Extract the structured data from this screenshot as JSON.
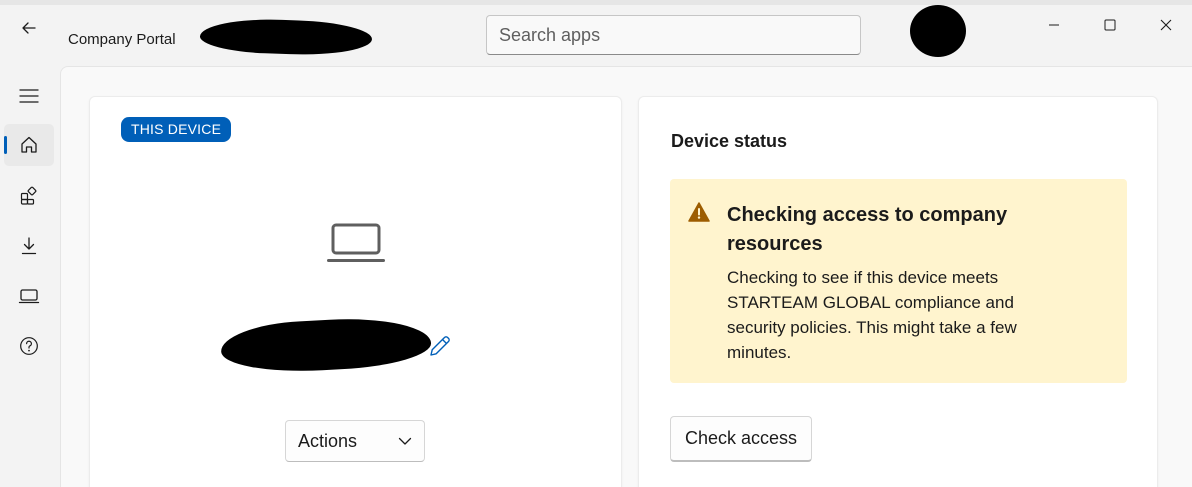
{
  "window": {
    "title": "Company Portal",
    "controls": {
      "minimize": "minimize-icon",
      "maximize": "maximize-icon",
      "close": "close-icon"
    }
  },
  "search": {
    "placeholder": "Search apps",
    "value": ""
  },
  "nav": {
    "items": [
      {
        "icon": "hamburger-menu-icon",
        "active": false
      },
      {
        "icon": "home-icon",
        "active": true
      },
      {
        "icon": "apps-icon",
        "active": false
      },
      {
        "icon": "download-icon",
        "active": false
      },
      {
        "icon": "laptop-icon",
        "active": false
      },
      {
        "icon": "help-icon",
        "active": false
      }
    ]
  },
  "device_card": {
    "badge": "THIS DEVICE",
    "device_icon": "laptop-icon",
    "edit_icon": "pencil-icon",
    "actions_label": "Actions"
  },
  "status_card": {
    "title": "Device status",
    "warning": {
      "icon": "warning-icon",
      "heading": "Checking access to company resources",
      "body": "Checking to see if this device meets STARTEAM GLOBAL compliance and security policies. This might take a few minutes."
    },
    "check_button": "Check access"
  },
  "colors": {
    "accent": "#005fb8",
    "warning_bg": "#fff4ce",
    "warning_icon": "#9d5d00",
    "background": "#f3f3f3",
    "card": "#ffffff"
  }
}
